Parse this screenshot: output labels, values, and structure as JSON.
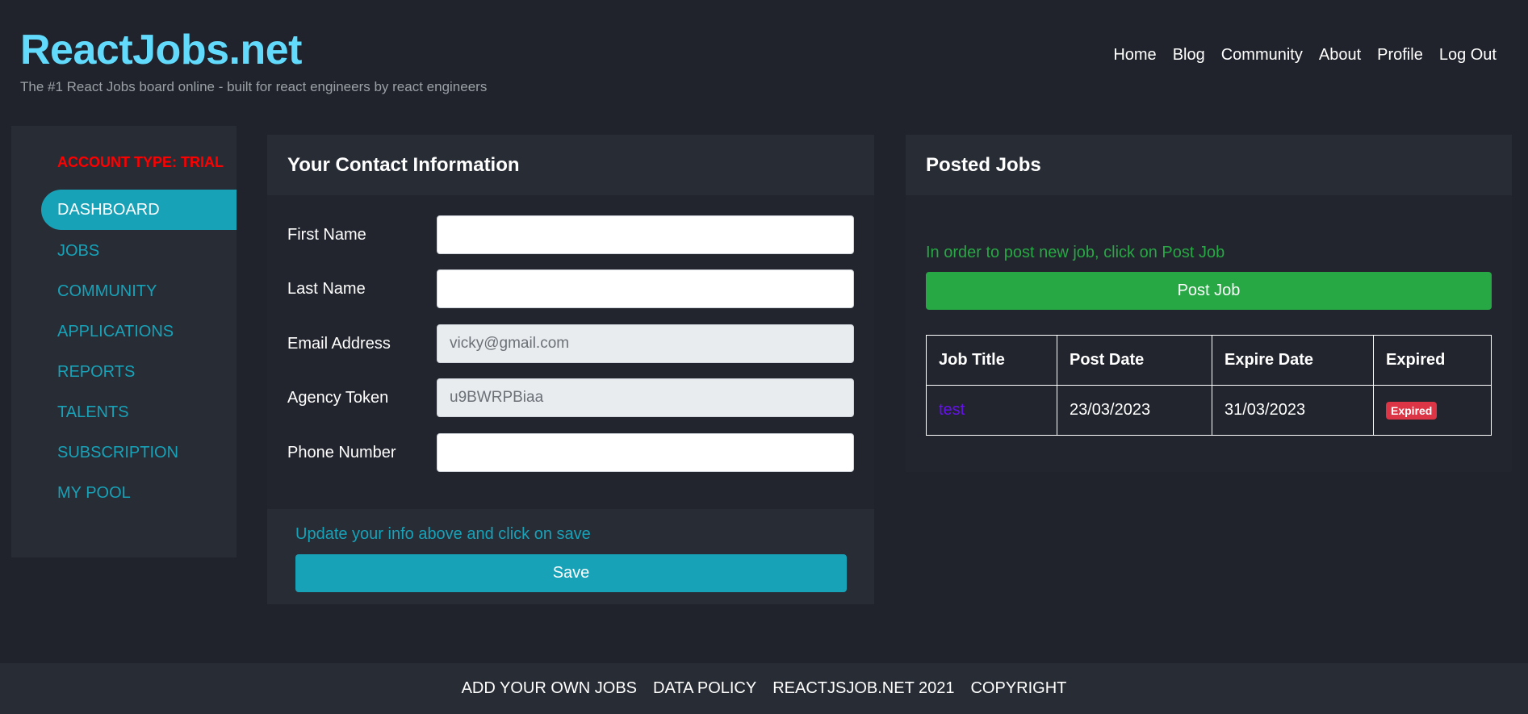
{
  "header": {
    "title": "ReactJobs.net",
    "tagline": "The #1 React Jobs board online - built for react engineers by react engineers"
  },
  "nav": {
    "items": [
      "Home",
      "Blog",
      "Community",
      "About",
      "Profile",
      "Log Out"
    ]
  },
  "sidebar": {
    "account_type": "ACCOUNT TYPE: TRIAL",
    "items": [
      {
        "label": "DASHBOARD",
        "active": true
      },
      {
        "label": "JOBS"
      },
      {
        "label": "COMMUNITY"
      },
      {
        "label": "APPLICATIONS"
      },
      {
        "label": "REPORTS"
      },
      {
        "label": "TALENTS"
      },
      {
        "label": "SUBSCRIPTION"
      },
      {
        "label": "MY POOL"
      }
    ]
  },
  "contact": {
    "title": "Your Contact Information",
    "fields": [
      {
        "label": "First Name",
        "value": ""
      },
      {
        "label": "Last Name",
        "value": ""
      },
      {
        "label": "Email Address",
        "value": "vicky@gmail.com"
      },
      {
        "label": "Agency Token",
        "value": "u9BWRPBiaa"
      },
      {
        "label": "Phone Number",
        "value": ""
      }
    ],
    "hint": "Update your info above and click on save",
    "save_label": "Save"
  },
  "jobs": {
    "title": "Posted Jobs",
    "hint": "In order to post new job, click on Post Job",
    "post_label": "Post Job",
    "columns": [
      "Job Title",
      "Post Date",
      "Expire Date",
      "Expired"
    ],
    "rows": [
      {
        "title": "test",
        "post_date": "23/03/2023",
        "expire_date": "31/03/2023",
        "expired": "Expired"
      }
    ]
  },
  "footer": {
    "links": [
      "ADD YOUR OWN JOBS",
      "DATA POLICY",
      "REACTJSJOB.NET 2021",
      "COPYRIGHT"
    ]
  },
  "colors": {
    "background": "#20232b",
    "panel": "#282c35",
    "brand": "#61dafb",
    "accent": "#17a2b8",
    "success": "#28a745",
    "danger": "#dc3545",
    "account_type": "#ff0000",
    "job_link": "#6610f2"
  }
}
